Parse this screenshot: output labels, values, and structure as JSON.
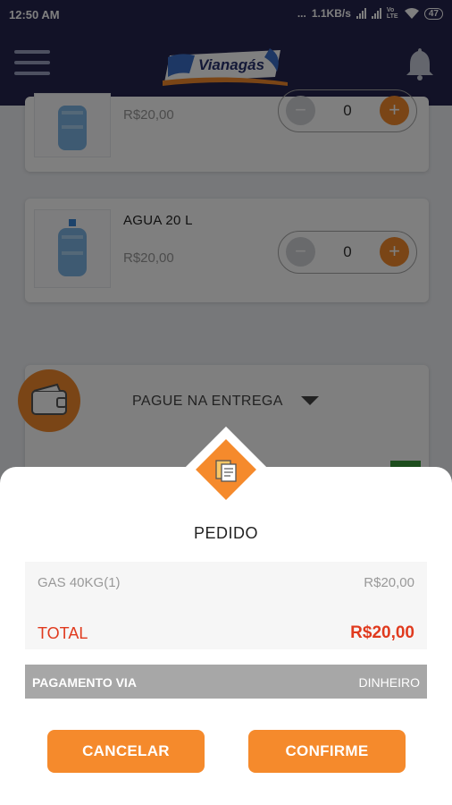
{
  "status_bar": {
    "time": "12:50 AM",
    "dots": "...",
    "speed": "1.1KB/s",
    "volte": "Vo LTE",
    "battery": "47"
  },
  "app_bar": {
    "logo_text": "Vianagás"
  },
  "products": [
    {
      "name": "",
      "price": "R$20,00",
      "quantity": "0"
    },
    {
      "name": "AGUA 20 L",
      "price": "R$20,00",
      "quantity": "0"
    }
  ],
  "stepper": {
    "minus": "−",
    "plus": "+"
  },
  "payment": {
    "selected": "PAGUE NA ENTREGA"
  },
  "order_sheet": {
    "title": "PEDIDO",
    "items": [
      {
        "name": "GAS 40KG(1)",
        "price": "R$20,00"
      }
    ],
    "total_label": "TOTAL",
    "total_value": "R$20,00",
    "payment_label": "PAGAMENTO VIA",
    "payment_value": "DINHEIRO",
    "cancel_label": "CANCELAR",
    "confirm_label": "CONFIRME"
  },
  "colors": {
    "primary": "#25244f",
    "accent": "#f58a2c",
    "total": "#e03a1e"
  }
}
